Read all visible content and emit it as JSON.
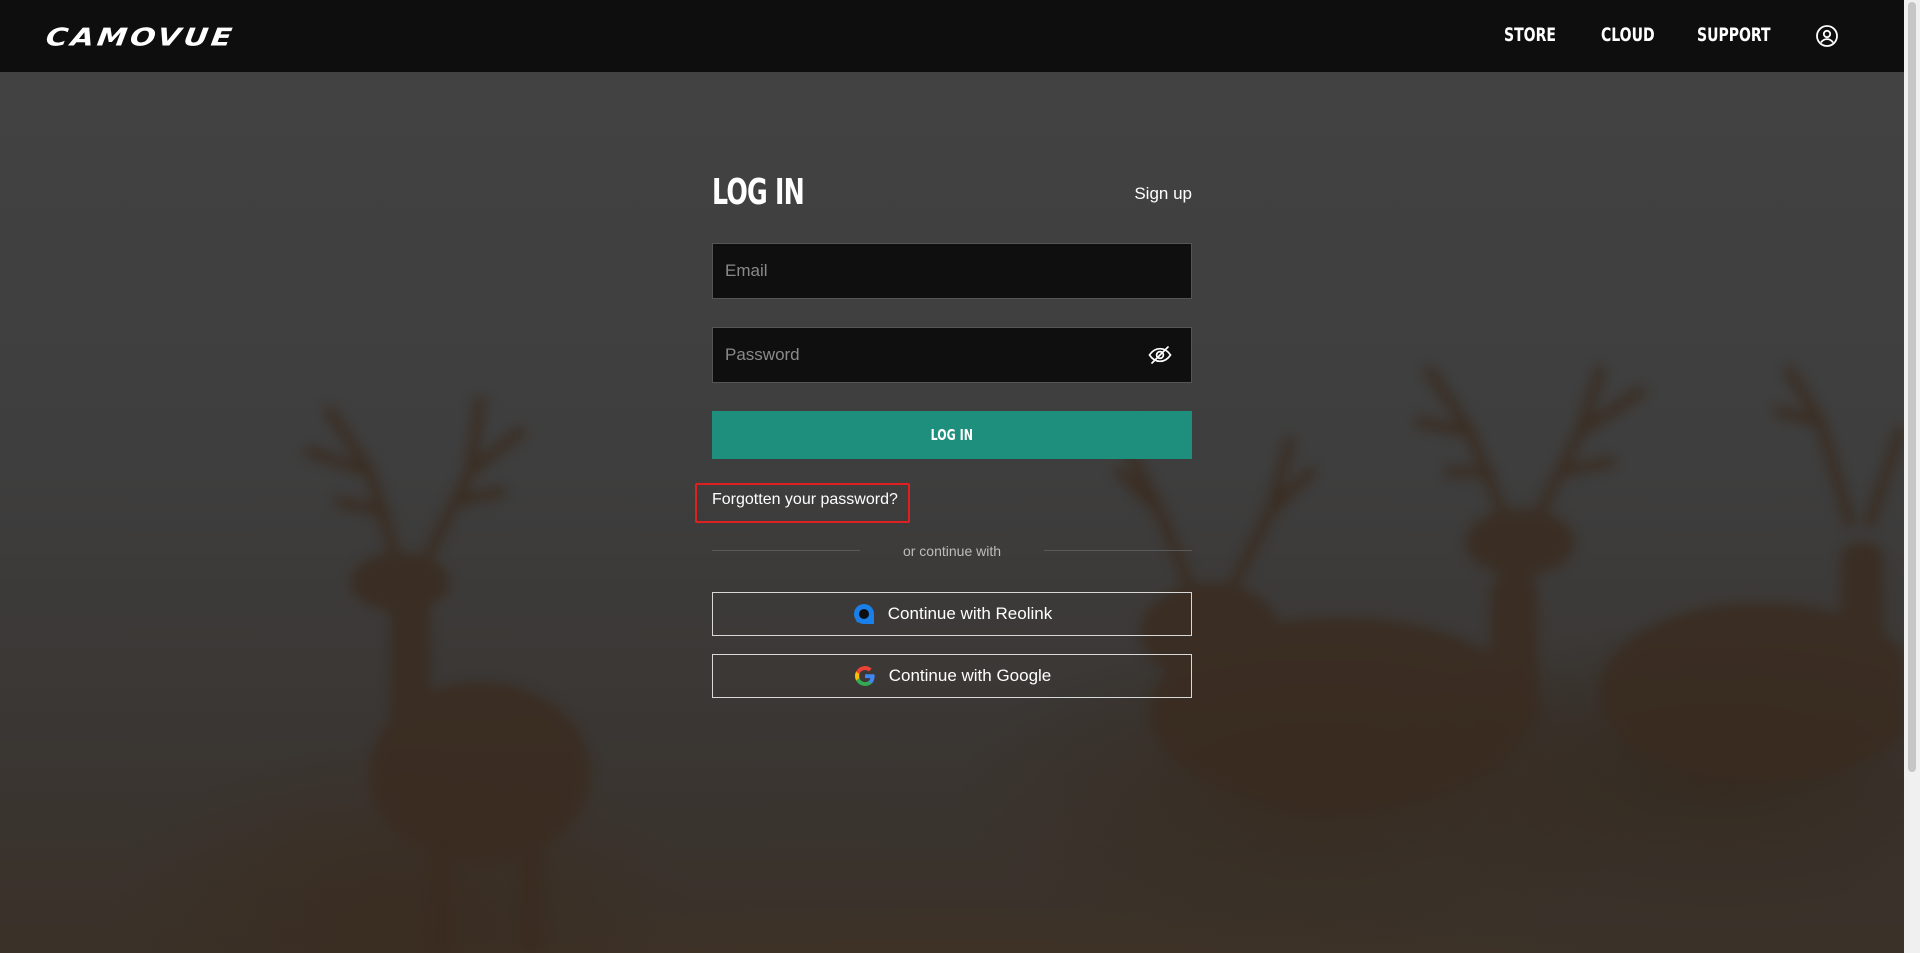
{
  "header": {
    "logo": "CAMOVUE",
    "nav": [
      {
        "label": "STORE"
      },
      {
        "label": "CLOUD"
      },
      {
        "label": "SUPPORT"
      }
    ],
    "user_icon": "user-circle-icon"
  },
  "login": {
    "title": "LOG IN",
    "signup_label": "Sign up",
    "email_placeholder": "Email",
    "password_placeholder": "Password",
    "password_toggle_icon": "eye-off-icon",
    "submit_label": "LOG IN",
    "forgot_label": "Forgotten your password?",
    "divider_text": "or continue with",
    "social": [
      {
        "label": "Continue with Reolink",
        "icon": "reolink-logo-icon"
      },
      {
        "label": "Continue with Google",
        "icon": "google-logo-icon"
      }
    ]
  },
  "colors": {
    "header_bg": "#0e0e0e",
    "accent": "#1e8e7d",
    "highlight_border": "#e02020",
    "reolink_blue": "#1a7fe8"
  }
}
